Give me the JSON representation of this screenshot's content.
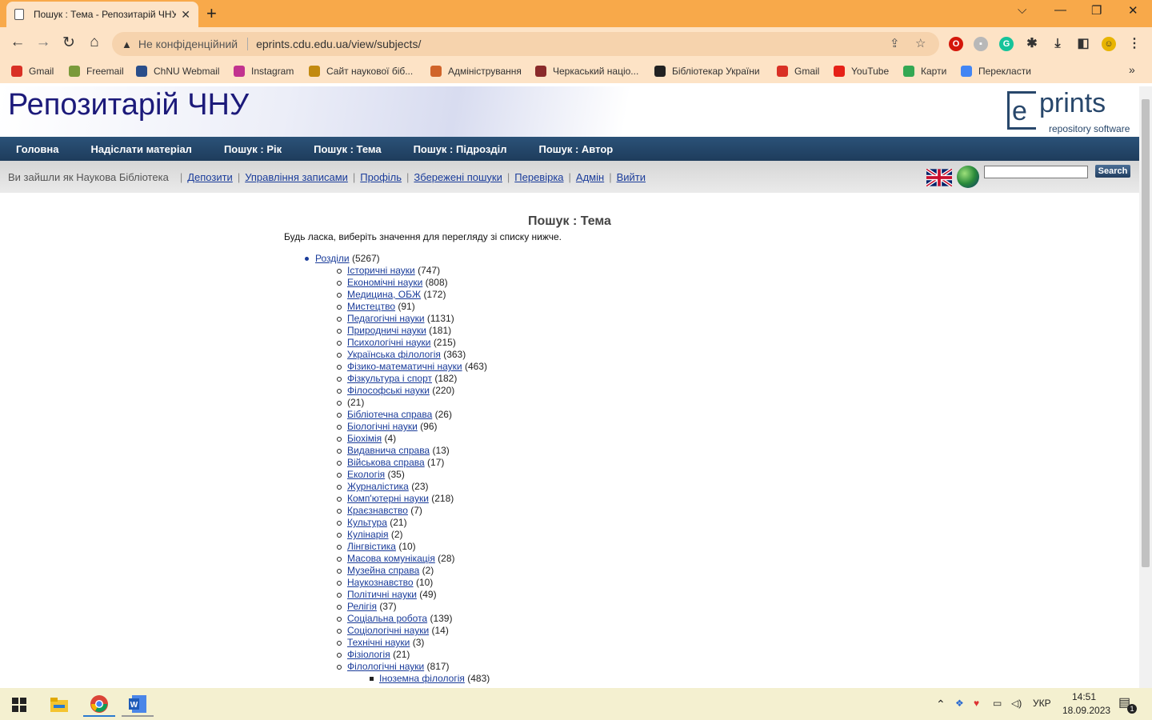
{
  "browser": {
    "tab_title": "Пошук : Тема - Репозитарій ЧНУ",
    "tab_close": "✕",
    "new_tab": "+",
    "window_controls": {
      "minimize": "⌵",
      "min": "—",
      "restore": "❐",
      "close": "✕"
    },
    "nav": {
      "back": "←",
      "forward": "→",
      "reload": "↻",
      "home": "⌂"
    },
    "address": {
      "security_label": "Не конфіденційний",
      "url": "eprints.cdu.edu.ua/view/subjects/"
    },
    "bookmarks": [
      {
        "label": "Gmail",
        "icon": "gmail-icon",
        "color": "#d93025"
      },
      {
        "label": "Freemail",
        "icon": "freemail-icon",
        "color": "#7a9a3a"
      },
      {
        "label": "ChNU Webmail",
        "icon": "webmail-icon",
        "color": "#2a4e8a"
      },
      {
        "label": "Instagram",
        "icon": "instagram-icon",
        "color": "#c2338f"
      },
      {
        "label": "Сайт наукової біб...",
        "icon": "library-icon",
        "color": "#c28a10"
      },
      {
        "label": "Адміністрування",
        "icon": "admin-icon",
        "color": "#d0642a"
      },
      {
        "label": "Черкаський націо...",
        "icon": "university-icon",
        "color": "#8a2a2a"
      },
      {
        "label": "Бібліотекар України",
        "icon": "librarian-icon",
        "color": "#222222"
      },
      {
        "label": "Gmail",
        "icon": "gmail-icon",
        "color": "#d93025"
      },
      {
        "label": "YouTube",
        "icon": "youtube-icon",
        "color": "#e62117"
      },
      {
        "label": "Карти",
        "icon": "maps-icon",
        "color": "#34a853"
      },
      {
        "label": "Перекласти",
        "icon": "translate-icon",
        "color": "#4285f4"
      }
    ],
    "bookmarks_more": "»"
  },
  "site": {
    "title": "Репозитарій ЧНУ",
    "logo_e": "e",
    "logo_prints": "prints",
    "logo_sub": "repository software",
    "menu": [
      "Головна",
      "Надіслати матеріал",
      "Пошук : Рік",
      "Пошук : Тема",
      "Пошук : Підрозділ",
      "Пошук : Автор"
    ],
    "logged_in_as": "Ви зайшли як Наукова Бібліотека",
    "user_links": [
      "Депозити",
      "Управління записами",
      "Профіль",
      "Збережені пошуки",
      "Перевірка",
      "Адмін",
      "Вийти"
    ],
    "search_button": "Search"
  },
  "content": {
    "heading": "Пошук : Тема",
    "intro": "Будь ласка, виберіть значення для перегляду зі списку нижче.",
    "tree": [
      {
        "level": 0,
        "label": "Розділи",
        "count": "(5267)"
      },
      {
        "level": 1,
        "label": "Історичні науки",
        "count": "(747)"
      },
      {
        "level": 1,
        "label": "Економічні науки",
        "count": "(808)"
      },
      {
        "level": 1,
        "label": "Медицина, ОБЖ",
        "count": "(172)"
      },
      {
        "level": 1,
        "label": "Мистецтво",
        "count": "(91)"
      },
      {
        "level": 1,
        "label": "Педагогічні науки",
        "count": "(1131)"
      },
      {
        "level": 1,
        "label": "Природничі науки",
        "count": "(181)"
      },
      {
        "level": 1,
        "label": "Психологічні науки",
        "count": "(215)"
      },
      {
        "level": 1,
        "label": "Українська філологія",
        "count": "(363)"
      },
      {
        "level": 1,
        "label": "Фізико-математичні науки",
        "count": "(463)"
      },
      {
        "level": 1,
        "label": "Фізкультура і спорт",
        "count": "(182)"
      },
      {
        "level": 1,
        "label": "Філософські науки",
        "count": "(220)"
      },
      {
        "level": 1,
        "label": "",
        "count": "(21)"
      },
      {
        "level": 1,
        "label": "Бібліотечна справа",
        "count": "(26)"
      },
      {
        "level": 1,
        "label": "Біологічні науки",
        "count": "(96)"
      },
      {
        "level": 1,
        "label": "Біохімія",
        "count": "(4)"
      },
      {
        "level": 1,
        "label": "Видавнича справа",
        "count": "(13)"
      },
      {
        "level": 1,
        "label": "Військова справа",
        "count": "(17)"
      },
      {
        "level": 1,
        "label": "Екологія",
        "count": "(35)"
      },
      {
        "level": 1,
        "label": "Журналістика",
        "count": "(23)"
      },
      {
        "level": 1,
        "label": "Комп'ютерні науки",
        "count": "(218)"
      },
      {
        "level": 1,
        "label": "Краєзнавство",
        "count": "(7)"
      },
      {
        "level": 1,
        "label": "Культура",
        "count": "(21)"
      },
      {
        "level": 1,
        "label": "Кулінарія",
        "count": "(2)"
      },
      {
        "level": 1,
        "label": "Лінгвістика",
        "count": "(10)"
      },
      {
        "level": 1,
        "label": "Масова комунікація",
        "count": "(28)"
      },
      {
        "level": 1,
        "label": "Музейна справа",
        "count": "(2)"
      },
      {
        "level": 1,
        "label": "Наукознавство",
        "count": "(10)"
      },
      {
        "level": 1,
        "label": "Політичні науки",
        "count": "(49)"
      },
      {
        "level": 1,
        "label": "Релігія",
        "count": "(37)"
      },
      {
        "level": 1,
        "label": "Соціальна робота",
        "count": "(139)"
      },
      {
        "level": 1,
        "label": "Соціологічні науки",
        "count": "(14)"
      },
      {
        "level": 1,
        "label": "Технічні науки",
        "count": "(3)"
      },
      {
        "level": 1,
        "label": "Фізіологія",
        "count": "(21)"
      },
      {
        "level": 1,
        "label": "Філологічні науки",
        "count": "(817)"
      },
      {
        "level": 2,
        "label": "Іноземна філологія",
        "count": "(483)"
      }
    ]
  },
  "taskbar": {
    "language": "УКР",
    "time": "14:51",
    "date": "18.09.2023",
    "notification_count": "1"
  }
}
